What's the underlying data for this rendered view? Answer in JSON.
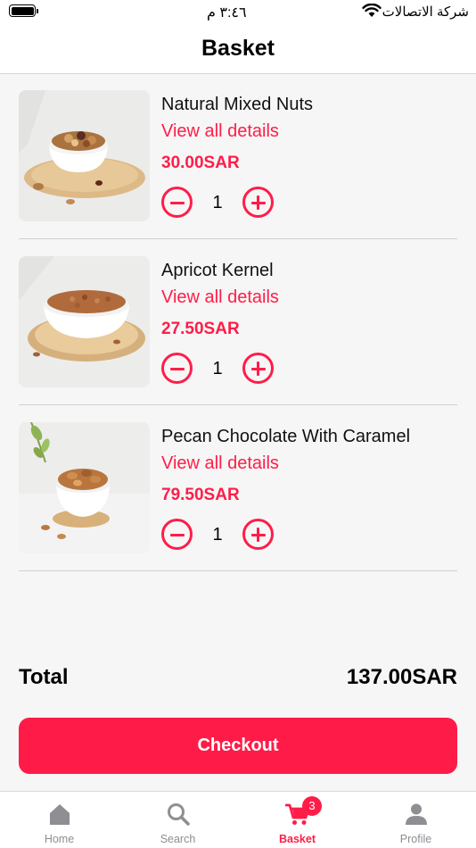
{
  "status_bar": {
    "time": "٣:٤٦ م",
    "carrier": "شركة الاتصالات"
  },
  "header": {
    "title": "Basket"
  },
  "items": [
    {
      "name": "Natural Mixed Nuts",
      "details_label": "View all details",
      "price": "30.00SAR",
      "quantity": "1"
    },
    {
      "name": "Apricot Kernel",
      "details_label": "View all details",
      "price": "27.50SAR",
      "quantity": "1"
    },
    {
      "name": "Pecan Chocolate With Caramel",
      "details_label": "View all details",
      "price": "79.50SAR",
      "quantity": "1"
    }
  ],
  "summary": {
    "total_label": "Total",
    "total_value": "137.00SAR"
  },
  "checkout_label": "Checkout",
  "tab_bar": {
    "tabs": [
      {
        "label": "Home",
        "icon": "home-icon"
      },
      {
        "label": "Search",
        "icon": "search-icon"
      },
      {
        "label": "Basket",
        "icon": "cart-icon",
        "badge": "3",
        "active": true
      },
      {
        "label": "Profile",
        "icon": "person-icon"
      }
    ]
  },
  "colors": {
    "accent": "#ff1d48",
    "inactive_tab": "#8e8e93"
  }
}
